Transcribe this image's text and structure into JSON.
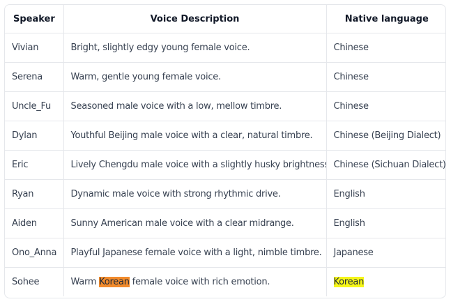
{
  "table": {
    "headers": {
      "speaker": "Speaker",
      "description": "Voice Description",
      "language": "Native language"
    },
    "rows": [
      {
        "speaker": "Vivian",
        "desc": "Bright, slightly edgy young female voice.",
        "lang": "Chinese"
      },
      {
        "speaker": "Serena",
        "desc": "Warm, gentle young female voice.",
        "lang": "Chinese"
      },
      {
        "speaker": "Uncle_Fu",
        "desc": "Seasoned male voice with a low, mellow timbre.",
        "lang": "Chinese"
      },
      {
        "speaker": "Dylan",
        "desc": "Youthful Beijing male voice with a clear, natural timbre.",
        "lang": "Chinese (Beijing Dialect)"
      },
      {
        "speaker": "Eric",
        "desc": "Lively Chengdu male voice with a slightly husky brightness.",
        "lang": "Chinese (Sichuan Dialect)"
      },
      {
        "speaker": "Ryan",
        "desc": "Dynamic male voice with strong rhythmic drive.",
        "lang": "English"
      },
      {
        "speaker": "Aiden",
        "desc": "Sunny American male voice with a clear midrange.",
        "lang": "English"
      },
      {
        "speaker": "Ono_Anna",
        "desc": "Playful Japanese female voice with a light, nimble timbre.",
        "lang": "Japanese"
      },
      {
        "speaker": "Sohee",
        "desc_before": "Warm ",
        "desc_highlight": "Korean",
        "desc_after": " female voice with rich emotion.",
        "lang": "Korean"
      }
    ]
  },
  "colors": {
    "highlight_orange": "#f28b2c",
    "highlight_yellow": "#f6f61a",
    "border": "#e5e7eb"
  }
}
